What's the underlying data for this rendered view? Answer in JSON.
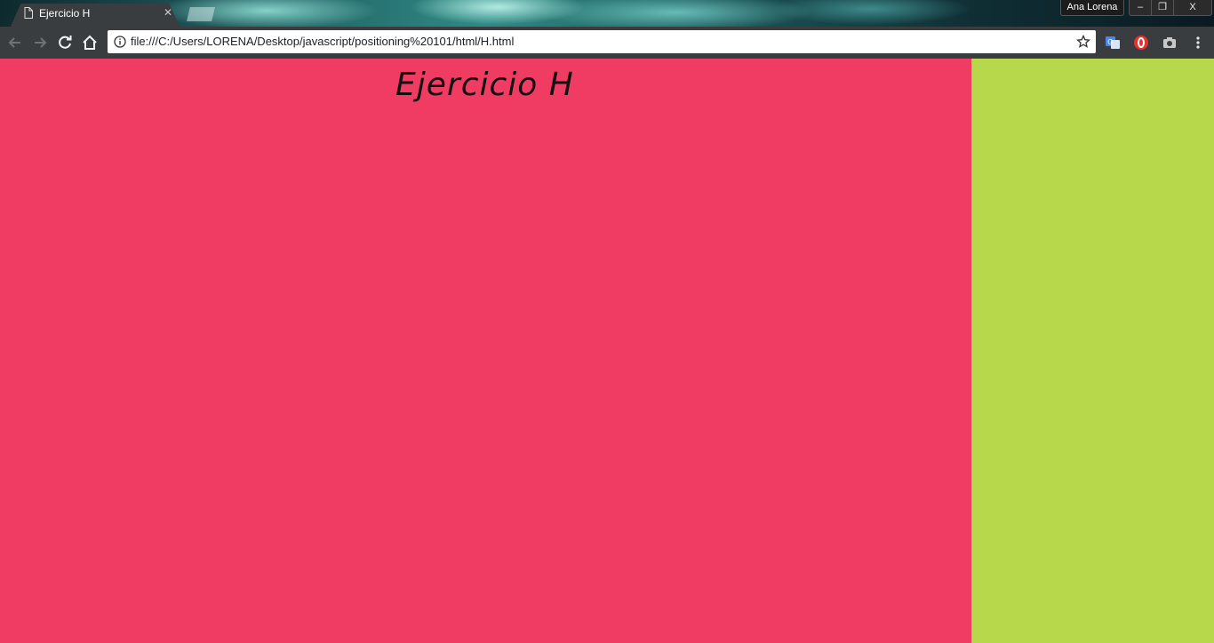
{
  "browser": {
    "tab": {
      "title": "Ejercicio H"
    },
    "profile_name": "Ana Lorena",
    "window_controls": {
      "minimize": "–",
      "maximize": "❐",
      "close": "X"
    },
    "address_bar": {
      "url": "file:///C:/Users/LORENA/Desktop/javascript/positioning%20101/html/H.html"
    },
    "icons": [
      "back-icon",
      "forward-icon",
      "reload-icon",
      "home-icon",
      "info-icon",
      "bookmark-star-icon",
      "translate-extension-icon",
      "adblock-extension-icon",
      "camera-extension-icon",
      "menu-icon"
    ]
  },
  "page": {
    "heading": "Ejercicio H",
    "colors": {
      "main": "#f03c62",
      "sidebar": "#b8d84c"
    }
  }
}
